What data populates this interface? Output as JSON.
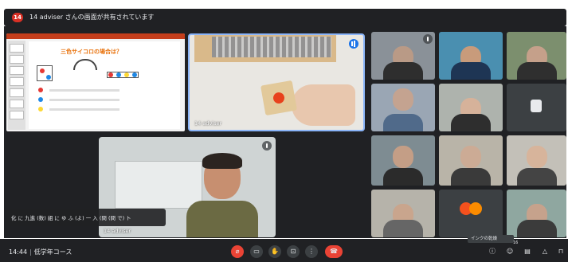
{
  "banner": {
    "avatar_initials": "14",
    "text": "14 adviser さんの画面が共有されています"
  },
  "slide": {
    "heading": "三色サイコロの場合は？",
    "accent": "#e8710a",
    "titlebar_color": "#c43e1c"
  },
  "dice_video": {
    "name": "14 adviser"
  },
  "presenter": {
    "name": "14 adviser"
  },
  "caption": {
    "text": "化 に 九進 (数) 組 に ゆ ふ (よ) 一 入 (問 (問 で) ト"
  },
  "bottom": {
    "time": "14:44",
    "separator": "|",
    "meeting_name": "低学年コース",
    "ink_tooltip": "インクの乾燥",
    "participant_badge": "16"
  },
  "colors": {
    "background": "#202124",
    "danger": "#ea4335",
    "active_border": "#8ab4f8",
    "speaking": "#1a73e8"
  },
  "icons": [
    "mic-off-icon",
    "captions-icon",
    "raise-hand-icon",
    "present-icon",
    "more-icon",
    "end-call-icon",
    "info-icon",
    "people-icon",
    "chat-icon",
    "activities-icon",
    "lock-icon"
  ]
}
